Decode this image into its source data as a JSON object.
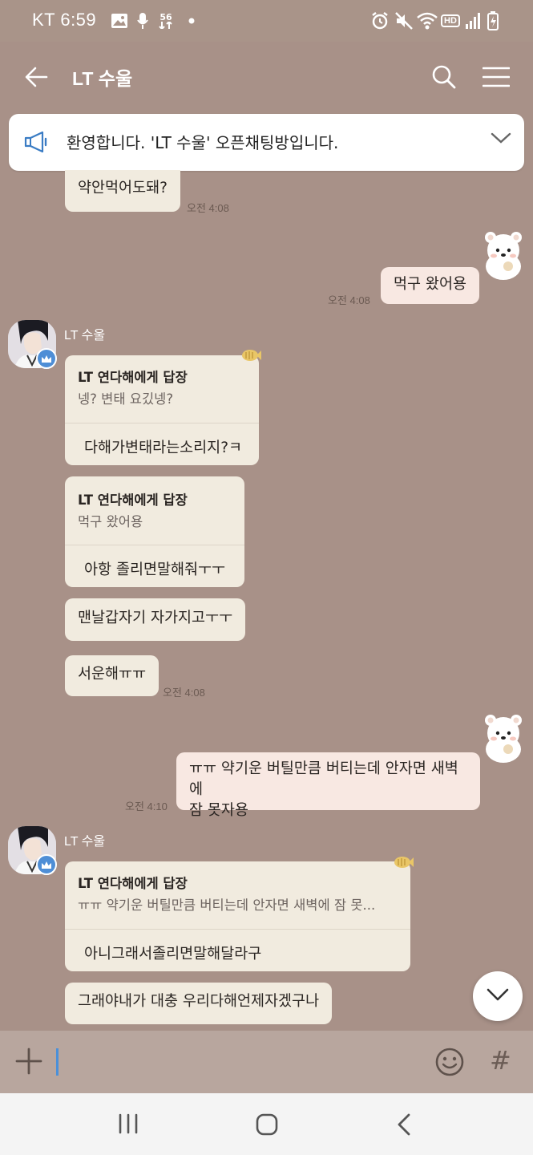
{
  "status_bar": {
    "carrier_time": "KT 6:59",
    "net_label": "56",
    "hd_label": "HD",
    "icons": [
      "gallery-icon",
      "mic-icon",
      "lte-icon",
      "dot-icon",
      "alarm-icon",
      "mute-icon",
      "wifi-icon",
      "hd-icon",
      "signal-icon",
      "battery-icon"
    ]
  },
  "header": {
    "title": "LT 수울",
    "back_icon": "back-arrow-icon",
    "search_icon": "search-icon",
    "menu_icon": "menu-icon"
  },
  "notice": {
    "text": "환영합니다. 'LT 수울' 오픈채팅방입니다."
  },
  "messages": {
    "m1": {
      "text": "약안먹어도돼?",
      "time": "오전 4:08"
    },
    "m2": {
      "text": "먹구 왔어용",
      "time": "오전 4:08"
    },
    "sender1": {
      "name": "LT 수울"
    },
    "r1": {
      "head": "LT 연다해에게 답장",
      "quote": "넹?  변태 요깄넹?",
      "body": "다해가변태라는소리지?ㅋ"
    },
    "r2": {
      "head": "LT 연다해에게 답장",
      "quote": "먹구 왔어용",
      "body": "아항 졸리면말해줘ㅜㅜ"
    },
    "m3": {
      "text": "맨날갑자기 자가지고ㅜㅜ"
    },
    "m4": {
      "text": "서운해ㅠㅠ",
      "time": "오전 4:08"
    },
    "m5": {
      "line1": "ㅠㅠ 약기운 버틸만큼 버티는데 안자면 새벽에",
      "line2": "잠 못자용",
      "time": "오전 4:10"
    },
    "sender2": {
      "name": "LT 수울"
    },
    "r3": {
      "head": "LT 연다해에게 답장",
      "quote": "ㅠㅠ 약기운 버틸만큼 버티는데 안자면 새벽에 잠 못...",
      "body": "아니그래서졸리면말해달라구"
    },
    "m6": {
      "text": "그래야내가 대충 우리다해언제자겠구나"
    }
  },
  "input_bar": {
    "plus_icon": "plus-icon",
    "emoji_icon": "emoji-icon",
    "hash_label": "#"
  },
  "colors": {
    "background": "#a89188",
    "bubble_other": "#f1ebdf",
    "bubble_mine": "#f8e8e2",
    "cursor": "#4a90d9",
    "crown": "#4e8ed6"
  }
}
